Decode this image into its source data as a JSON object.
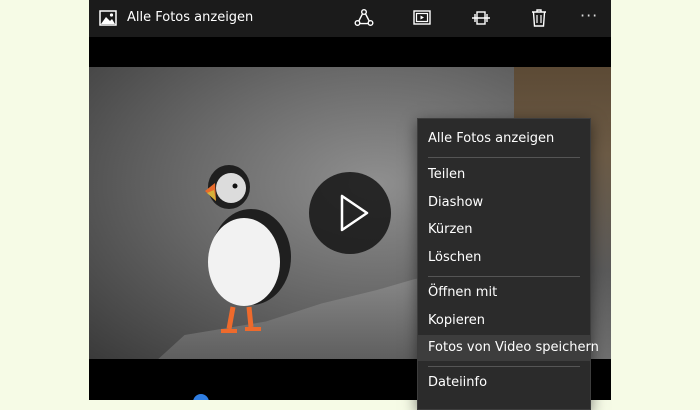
{
  "header": {
    "title": "Alle Fotos anzeigen"
  },
  "menu": {
    "items": [
      {
        "label": "Alle Fotos anzeigen"
      },
      {
        "label": "Teilen"
      },
      {
        "label": "Diashow"
      },
      {
        "label": "Kürzen"
      },
      {
        "label": "Löschen"
      },
      {
        "label": "Öffnen mit"
      },
      {
        "label": "Kopieren"
      },
      {
        "label": "Fotos von Video speichern",
        "highlighted": true
      },
      {
        "label": "Dateiinfo"
      }
    ]
  },
  "icons": {
    "app": "photos-icon",
    "share": "share-icon",
    "slideshow": "slideshow-icon",
    "trim": "trim-icon",
    "delete": "delete-icon",
    "more": "more-icon",
    "play": "play-icon"
  },
  "colors": {
    "accent": "#2f7de1",
    "menu_bg": "#2b2b2b",
    "menu_highlight": "#3d3d3d",
    "topbar_bg": "#1b1b1b"
  }
}
